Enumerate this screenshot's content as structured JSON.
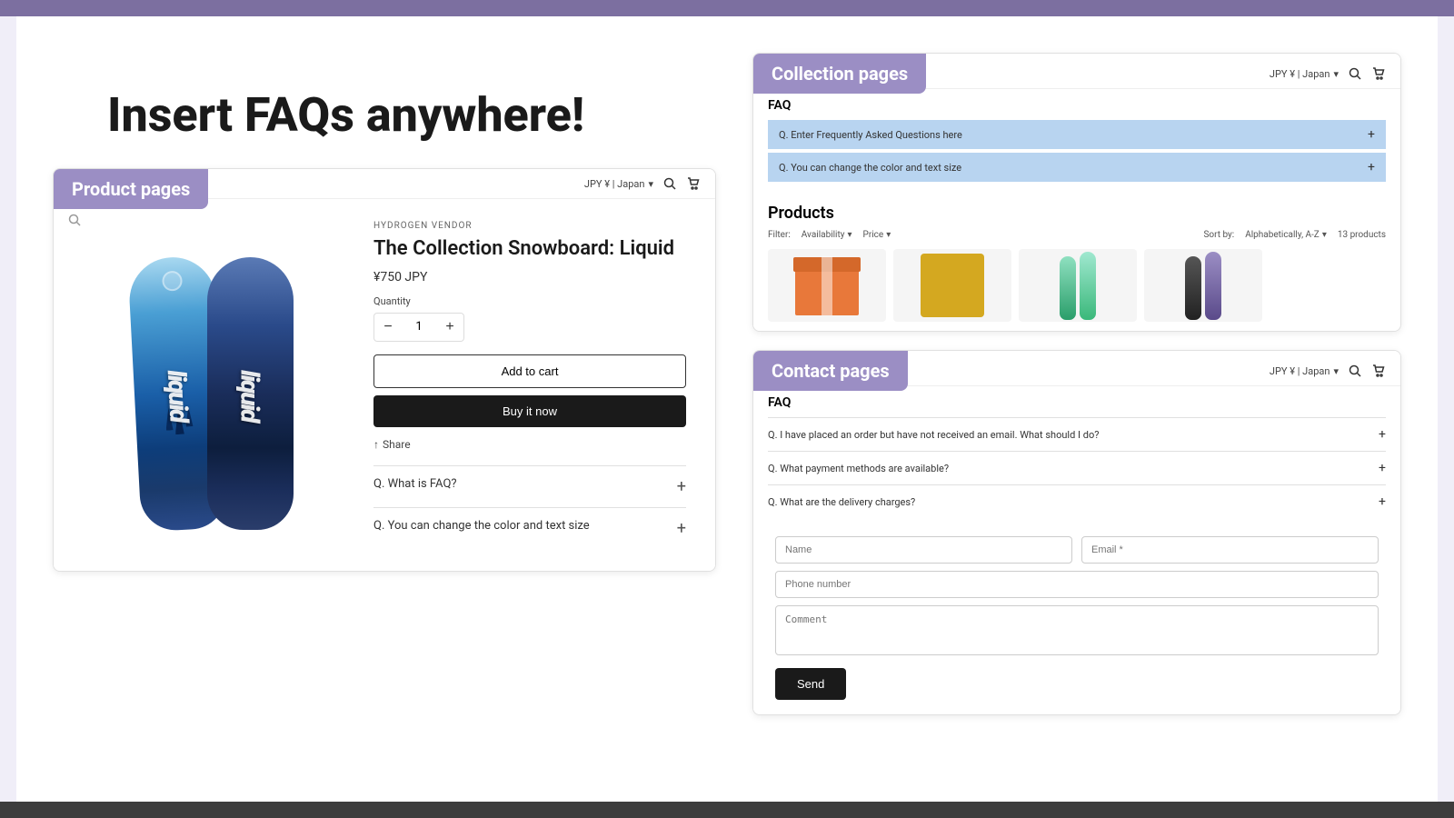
{
  "topBar": {
    "color": "#7c6fa0"
  },
  "bottomBar": {
    "color": "#3d3d3d"
  },
  "hero": {
    "title": "Insert FAQs anywhere!"
  },
  "productCard": {
    "label": "Product pages",
    "nav": {
      "currency": "JPY ¥ | Japan",
      "chevron": "▾"
    },
    "vendor": "HYDROGEN VENDOR",
    "productTitle": "The Collection Snowboard: Liquid",
    "price": "¥750 JPY",
    "quantityLabel": "Quantity",
    "quantity": "1",
    "addToCart": "Add to cart",
    "buyNow": "Buy it now",
    "shareLabel": "Share",
    "faqItems": [
      {
        "question": "Q. What is FAQ?"
      },
      {
        "question": "Q. You can change the color and text size"
      }
    ]
  },
  "collectionCard": {
    "label": "Collection pages",
    "nav": {
      "currency": "JPY ¥ | Japan"
    },
    "faqHeading": "FAQ",
    "faqItems": [
      {
        "question": "Q. Enter Frequently Asked Questions here"
      },
      {
        "question": "Q. You can change the color and text size"
      }
    ],
    "productsHeading": "Products",
    "filter": {
      "filterLabel": "Filter:",
      "availability": "Availability",
      "price": "Price",
      "sortLabel": "Sort by:",
      "sortValue": "Alphabetically, A-Z",
      "count": "13 products"
    }
  },
  "contactCard": {
    "label": "Contact pages",
    "nav": {
      "currency": "JPY ¥ | Japan"
    },
    "faqHeading": "FAQ",
    "faqItems": [
      {
        "question": "Q. I have placed an order but have not received an email. What should I do?"
      },
      {
        "question": "Q. What payment methods are available?"
      },
      {
        "question": "Q. What are the delivery charges?"
      }
    ],
    "form": {
      "namePlaceholder": "Name",
      "emailPlaceholder": "Email *",
      "phonePlaceholder": "Phone number",
      "commentPlaceholder": "Comment"
    },
    "submitLabel": "Send"
  }
}
